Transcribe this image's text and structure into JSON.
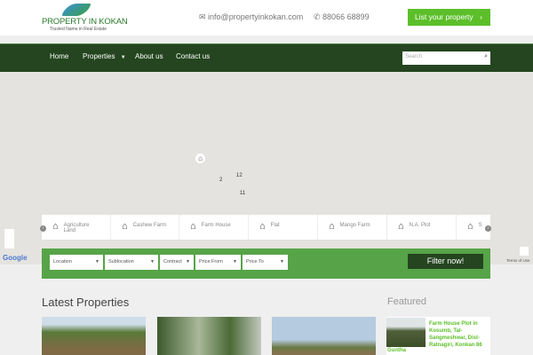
{
  "header": {
    "logo_title": "PROPERTY IN KOKAN",
    "logo_tagline": "Trusted Name in Real Estate",
    "email": "info@propertyinkokan.com",
    "phone": "88066 68899",
    "list_button": "List your property"
  },
  "nav": {
    "items": [
      "Home",
      "Properties",
      "About us",
      "Contact us"
    ],
    "search_placeholder": "Search"
  },
  "map": {
    "markers": [
      "12",
      "2",
      "11"
    ],
    "google": "Google",
    "terms": "Terms of Use"
  },
  "categories": [
    "Agriculture Land",
    "Cashew Farm",
    "Farm House",
    "Flat",
    "Mango Farm",
    "N.A. Plot",
    "S"
  ],
  "filter": {
    "selects": [
      "Location",
      "Sublocation",
      "Contract",
      "Price From",
      "Price To"
    ],
    "button": "Filter now!"
  },
  "latest": {
    "title": "Latest Properties"
  },
  "featured": {
    "title": "Featured",
    "item_title": "Farm House Plot in Kosumb, Tal-Sangmeshwar, Dist-Ratnagiri, Konkan 86",
    "item_title_cont": "Guntha"
  },
  "colors": {
    "green": "#5cbf2a",
    "dark_green": "#24451f",
    "filter_bg": "#56a447"
  }
}
